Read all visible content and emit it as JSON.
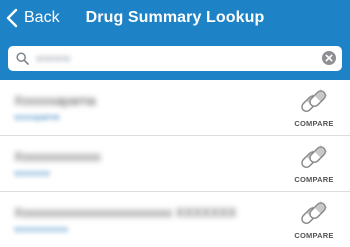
{
  "header": {
    "back_label": "Back",
    "title": "Drug Summary Lookup"
  },
  "search": {
    "value": "wwww"
  },
  "results": [
    {
      "name": "Xxxxxxaparna",
      "generic": "xxxxxparne",
      "compare_label": "COMPARE"
    },
    {
      "name": "Xxxxxxxxxxxxx",
      "generic": "xxxxxxxx",
      "compare_label": "COMPARE"
    },
    {
      "name": "Xxxxxxxxxxxxxxxxxxxxxxxx XXXXXXX",
      "generic": "xxxxxxxxxxxx",
      "compare_label": "COMPARE"
    }
  ],
  "colors": {
    "header_bg": "#1d82c6",
    "link_text": "#2f7fc0",
    "divider": "#dedede"
  }
}
